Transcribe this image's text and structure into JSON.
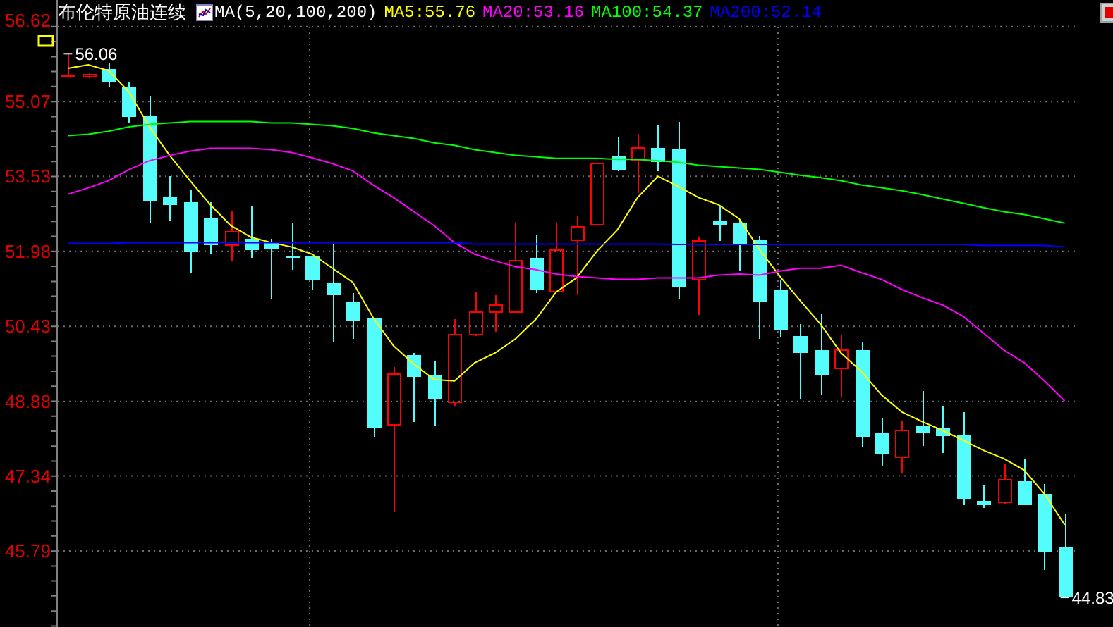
{
  "header": {
    "title": "布伦特原油连续",
    "indicator": "MA(5,20,100,200)",
    "legend": [
      {
        "text": "MA5:55.76",
        "color": "#ffff00"
      },
      {
        "text": "MA20:53.16",
        "color": "#ff00ff"
      },
      {
        "text": "MA100:54.37",
        "color": "#00ff00"
      },
      {
        "text": "MA200:52.14",
        "color": "#0000ff"
      }
    ]
  },
  "chart": {
    "chart_data": {
      "type": "candlestick",
      "ylim": [
        44.22,
        57.17
      ],
      "yticks": [
        56.62,
        55.07,
        53.53,
        51.98,
        50.43,
        48.88,
        47.34,
        45.79
      ],
      "grid": true,
      "ohlc": [
        [
          55.6,
          56.06,
          55.58,
          55.62
        ],
        [
          55.58,
          55.65,
          55.56,
          55.63
        ],
        [
          55.74,
          55.86,
          55.36,
          55.48
        ],
        [
          55.36,
          55.48,
          54.63,
          54.75
        ],
        [
          54.78,
          55.19,
          52.56,
          53.03
        ],
        [
          53.09,
          53.53,
          52.62,
          52.94
        ],
        [
          53.0,
          53.26,
          51.54,
          51.98
        ],
        [
          52.68,
          53.0,
          51.92,
          52.1
        ],
        [
          52.1,
          52.8,
          51.78,
          52.39
        ],
        [
          52.24,
          52.91,
          51.84,
          52.01
        ],
        [
          52.16,
          52.24,
          50.99,
          52.04
        ],
        [
          51.89,
          52.56,
          51.6,
          51.84
        ],
        [
          51.89,
          51.89,
          51.17,
          51.4
        ],
        [
          51.34,
          52.13,
          50.12,
          51.08
        ],
        [
          50.93,
          51.11,
          50.17,
          50.55
        ],
        [
          50.61,
          50.61,
          48.13,
          48.34
        ],
        [
          48.4,
          49.59,
          46.59,
          49.45
        ],
        [
          49.83,
          49.88,
          48.46,
          49.39
        ],
        [
          49.42,
          49.71,
          48.37,
          48.92
        ],
        [
          48.86,
          50.58,
          48.78,
          50.26
        ],
        [
          50.26,
          51.14,
          50.23,
          50.73
        ],
        [
          50.73,
          51.08,
          50.32,
          50.87
        ],
        [
          50.73,
          52.56,
          50.73,
          51.78
        ],
        [
          51.84,
          52.33,
          51.11,
          51.17
        ],
        [
          51.14,
          52.56,
          51.14,
          52.01
        ],
        [
          52.21,
          52.71,
          51.08,
          52.48
        ],
        [
          52.53,
          53.79,
          52.53,
          53.79
        ],
        [
          53.96,
          54.34,
          53.64,
          53.67
        ],
        [
          53.85,
          54.4,
          53.18,
          54.11
        ],
        [
          54.11,
          54.6,
          53.64,
          53.82
        ],
        [
          54.08,
          54.66,
          50.99,
          51.25
        ],
        [
          51.4,
          52.27,
          50.67,
          52.19
        ],
        [
          52.62,
          52.91,
          52.19,
          52.51
        ],
        [
          52.56,
          52.65,
          51.57,
          52.13
        ],
        [
          52.21,
          52.3,
          50.17,
          50.93
        ],
        [
          51.17,
          51.4,
          50.2,
          50.35
        ],
        [
          50.23,
          50.47,
          48.92,
          49.88
        ],
        [
          49.94,
          50.7,
          49.01,
          49.42
        ],
        [
          49.56,
          50.26,
          48.98,
          49.94
        ],
        [
          49.94,
          50.12,
          47.93,
          48.13
        ],
        [
          48.22,
          48.54,
          47.55,
          47.79
        ],
        [
          47.73,
          48.48,
          47.41,
          48.28
        ],
        [
          48.37,
          49.1,
          47.96,
          48.22
        ],
        [
          48.34,
          48.78,
          47.81,
          48.16
        ],
        [
          48.19,
          48.66,
          46.74,
          46.85
        ],
        [
          46.82,
          47.14,
          46.68,
          46.74
        ],
        [
          46.79,
          47.58,
          46.77,
          47.26
        ],
        [
          47.23,
          47.7,
          46.74,
          46.74
        ],
        [
          46.97,
          47.17,
          45.4,
          45.77
        ],
        [
          45.86,
          46.56,
          44.83,
          44.83
        ]
      ],
      "series": [
        {
          "type": "line",
          "color": "#ffff00",
          "values": [
            55.76,
            55.83,
            55.71,
            55.27,
            54.55,
            53.96,
            53.44,
            52.94,
            52.51,
            52.27,
            52.16,
            52.07,
            51.92,
            51.63,
            51.34,
            50.61,
            50.03,
            49.65,
            49.33,
            49.3,
            49.68,
            49.88,
            50.17,
            50.58,
            51.14,
            51.43,
            51.98,
            52.42,
            53.09,
            53.53,
            53.32,
            53.09,
            52.94,
            52.65,
            52.01,
            51.46,
            50.96,
            50.47,
            49.88,
            49.5,
            49.01,
            48.66,
            48.46,
            48.28,
            48.08,
            47.87,
            47.7,
            47.46,
            46.97,
            46.33
          ]
        },
        {
          "type": "line",
          "color": "#ff00ff",
          "values": [
            53.16,
            53.29,
            53.44,
            53.67,
            53.85,
            53.96,
            54.05,
            54.11,
            54.11,
            54.11,
            54.08,
            54.02,
            53.91,
            53.79,
            53.64,
            53.35,
            53.09,
            52.8,
            52.51,
            52.16,
            51.92,
            51.78,
            51.66,
            51.6,
            51.51,
            51.46,
            51.43,
            51.4,
            51.4,
            51.43,
            51.43,
            51.43,
            51.49,
            51.51,
            51.49,
            51.57,
            51.63,
            51.63,
            51.69,
            51.54,
            51.4,
            51.19,
            51.02,
            50.87,
            50.64,
            50.29,
            49.94,
            49.68,
            49.3,
            48.89
          ]
        },
        {
          "type": "line",
          "color": "#00ff00",
          "values": [
            54.37,
            54.4,
            54.46,
            54.55,
            54.6,
            54.63,
            54.66,
            54.66,
            54.66,
            54.66,
            54.63,
            54.63,
            54.6,
            54.57,
            54.52,
            54.43,
            54.37,
            54.31,
            54.22,
            54.17,
            54.08,
            54.02,
            53.96,
            53.93,
            53.9,
            53.9,
            53.9,
            53.88,
            53.88,
            53.85,
            53.82,
            53.76,
            53.73,
            53.7,
            53.67,
            53.61,
            53.55,
            53.5,
            53.44,
            53.35,
            53.29,
            53.23,
            53.15,
            53.06,
            52.97,
            52.88,
            52.8,
            52.74,
            52.65,
            52.56
          ]
        },
        {
          "type": "line",
          "color": "#0000ff",
          "values": [
            52.14,
            52.14,
            52.14,
            52.16,
            52.16,
            52.16,
            52.16,
            52.16,
            52.16,
            52.16,
            52.16,
            52.16,
            52.16,
            52.16,
            52.16,
            52.16,
            52.16,
            52.16,
            52.16,
            52.16,
            52.13,
            52.13,
            52.13,
            52.13,
            52.13,
            52.13,
            52.13,
            52.13,
            52.13,
            52.13,
            52.12,
            52.12,
            52.12,
            52.12,
            52.12,
            52.12,
            52.12,
            52.12,
            52.12,
            52.12,
            52.12,
            52.12,
            52.12,
            52.12,
            52.12,
            52.1,
            52.1,
            52.1,
            52.1,
            52.07
          ]
        }
      ],
      "annotations": [
        "56.06",
        "44.83"
      ]
    }
  }
}
